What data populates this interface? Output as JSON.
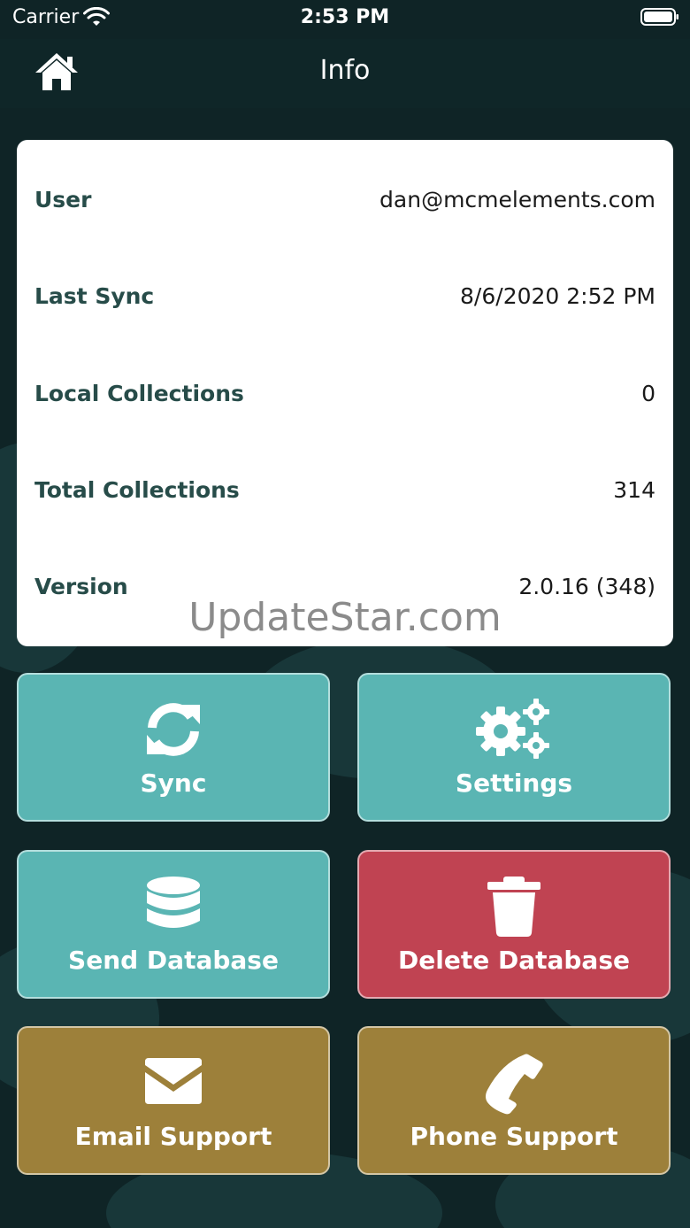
{
  "status_bar": {
    "carrier": "Carrier",
    "time": "2:53 PM"
  },
  "nav": {
    "title": "Info"
  },
  "info": {
    "rows": [
      {
        "label": "User",
        "value": "dan@mcmelements.com"
      },
      {
        "label": "Last Sync",
        "value": "8/6/2020 2:52 PM"
      },
      {
        "label": "Local Collections",
        "value": "0"
      },
      {
        "label": "Total Collections",
        "value": "314"
      },
      {
        "label": "Version",
        "value": "2.0.16 (348)"
      }
    ]
  },
  "watermark": "UpdateStar.com",
  "actions": {
    "sync": {
      "label": "Sync",
      "icon": "sync-icon"
    },
    "settings": {
      "label": "Settings",
      "icon": "gears-icon"
    },
    "send_database": {
      "label": "Send Database",
      "icon": "database-icon"
    },
    "delete_database": {
      "label": "Delete Database",
      "icon": "trash-icon"
    },
    "email_support": {
      "label": "Email Support",
      "icon": "envelope-icon"
    },
    "phone_support": {
      "label": "Phone Support",
      "icon": "phone-icon"
    }
  },
  "colors": {
    "background": "#0f2426",
    "teal": "#5ab5b3",
    "red": "#c04352",
    "gold": "#9d803a",
    "label_text": "#274c49"
  }
}
